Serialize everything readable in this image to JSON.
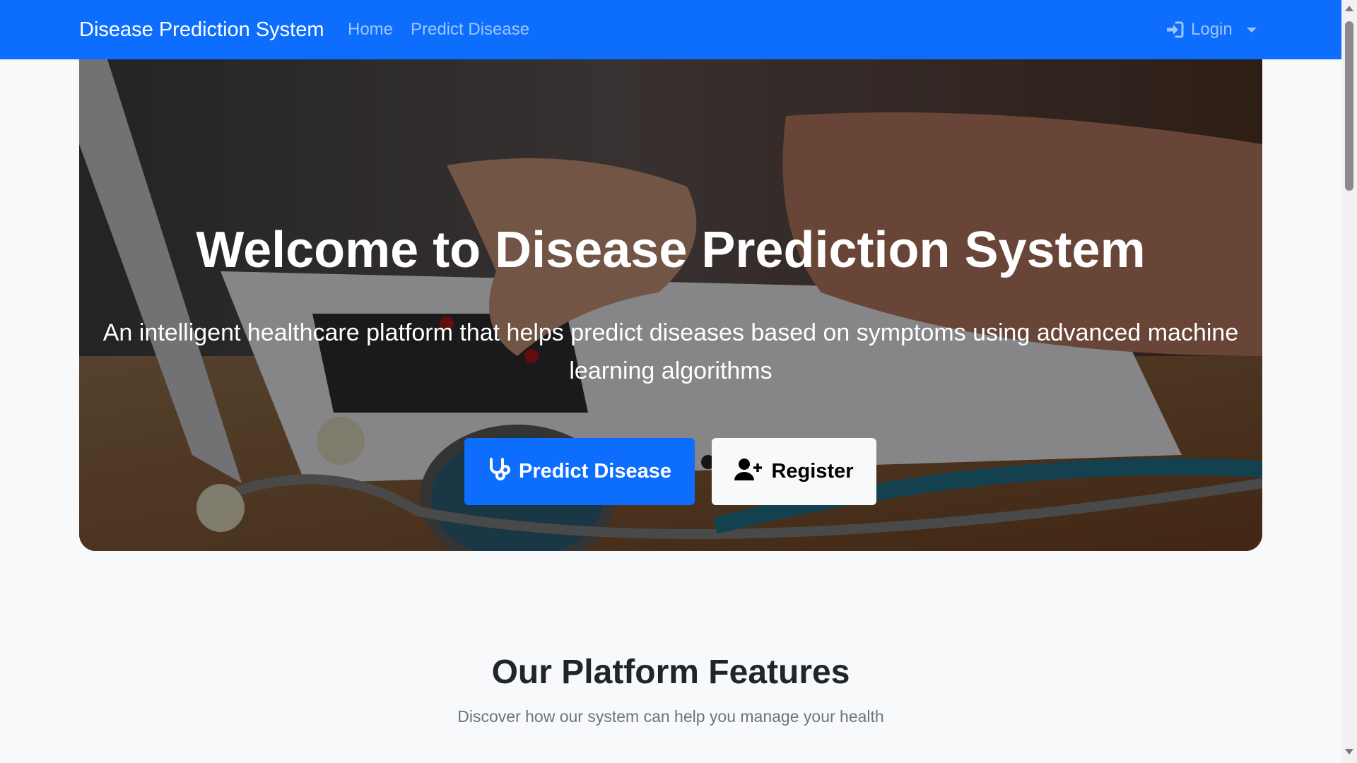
{
  "navbar": {
    "brand": "Disease Prediction System",
    "links": [
      {
        "label": "Home"
      },
      {
        "label": "Predict Disease"
      }
    ],
    "login_label": "Login",
    "background": "#0d6efd"
  },
  "hero": {
    "title": "Welcome to Disease Prediction System",
    "subtitle": "An intelligent healthcare platform that helps predict diseases based on symptoms using advanced machine learning algorithms",
    "buttons": {
      "predict_label": "Predict Disease",
      "predict_icon": "stethoscope-icon",
      "register_label": "Register",
      "register_icon": "user-plus-icon"
    }
  },
  "features": {
    "title": "Our Platform Features",
    "subtitle": "Discover how our system can help you manage your health"
  },
  "colors": {
    "primary": "#0d6efd",
    "page_bg": "#f8f9fa"
  }
}
